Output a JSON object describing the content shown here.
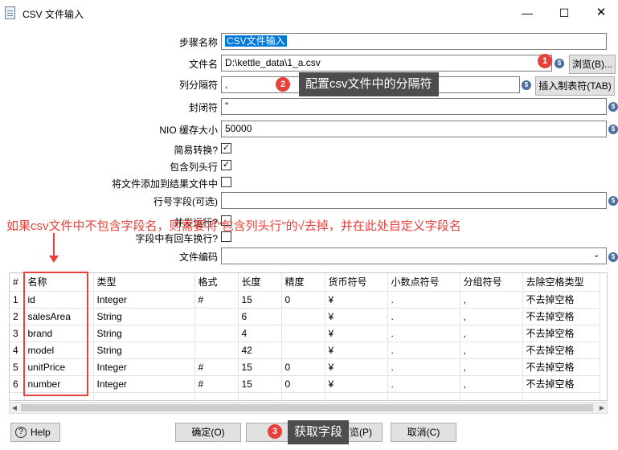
{
  "window": {
    "title": "CSV 文件输入",
    "min": "—",
    "max": "☐",
    "close": "✕"
  },
  "form": {
    "step_name_label": "步骤名称",
    "step_name_value": "CSV文件输入",
    "filename_label": "文件名",
    "filename_value": "D:\\kettle_data\\1_a.csv",
    "browse_label": "浏览(B)...",
    "delimiter_label": "列分隔符",
    "delimiter_value": ",",
    "insert_tab_label": "插入制表符(TAB)",
    "enclosure_label": "封闭符",
    "enclosure_value": "\"",
    "nio_label": "NIO 缓存大小",
    "nio_value": "50000",
    "lazy_label": "简易转换?",
    "lazy_checked": true,
    "header_label": "包含列头行",
    "header_checked": true,
    "add_result_label": "将文件添加到结果文件中",
    "add_result_checked": false,
    "rownum_label": "行号字段(可选)",
    "rownum_value": "",
    "parallel_label": "并发运行?",
    "parallel_checked": false,
    "newline_label": "字段中有回车换行?",
    "newline_checked": false,
    "encoding_label": "文件编码",
    "encoding_value": ""
  },
  "annotations": {
    "badge1": "1",
    "badge2": "2",
    "badge3": "3",
    "tip2": "配置csv文件中的分隔符",
    "tip3": "获取字段",
    "red_note": "如果csv文件中不包含字段名，则需要将“包含列头行”的√去掉，并在此处自定义字段名"
  },
  "table": {
    "headers": [
      "#",
      "名称",
      "类型",
      "格式",
      "长度",
      "精度",
      "货币符号",
      "小数点符号",
      "分组符号",
      "去除空格类型"
    ],
    "rows": [
      [
        "1",
        "id",
        "Integer",
        "#",
        "15",
        "0",
        "¥",
        ".",
        ",",
        "不去掉空格"
      ],
      [
        "2",
        "salesArea",
        "String",
        "",
        "6",
        "",
        "¥",
        ".",
        ",",
        "不去掉空格"
      ],
      [
        "3",
        "brand",
        "String",
        "",
        "4",
        "",
        "¥",
        ".",
        ",",
        "不去掉空格"
      ],
      [
        "4",
        "model",
        "String",
        "",
        "42",
        "",
        "¥",
        ".",
        ",",
        "不去掉空格"
      ],
      [
        "5",
        "unitPrice",
        "Integer",
        "#",
        "15",
        "0",
        "¥",
        ".",
        ",",
        "不去掉空格"
      ],
      [
        "6",
        "number",
        "Integer",
        "#",
        "15",
        "0",
        "¥",
        ".",
        ",",
        "不去掉空格"
      ]
    ]
  },
  "buttons": {
    "help": "Help",
    "ok": "确定(O)",
    "get_fields": "获取字段",
    "preview": "预览(P)",
    "cancel": "取消(C)"
  },
  "colors": {
    "annotation_red": "#e8403a",
    "selection_blue": "#0078d7",
    "tooltip_bg": "#4d4d4d"
  }
}
